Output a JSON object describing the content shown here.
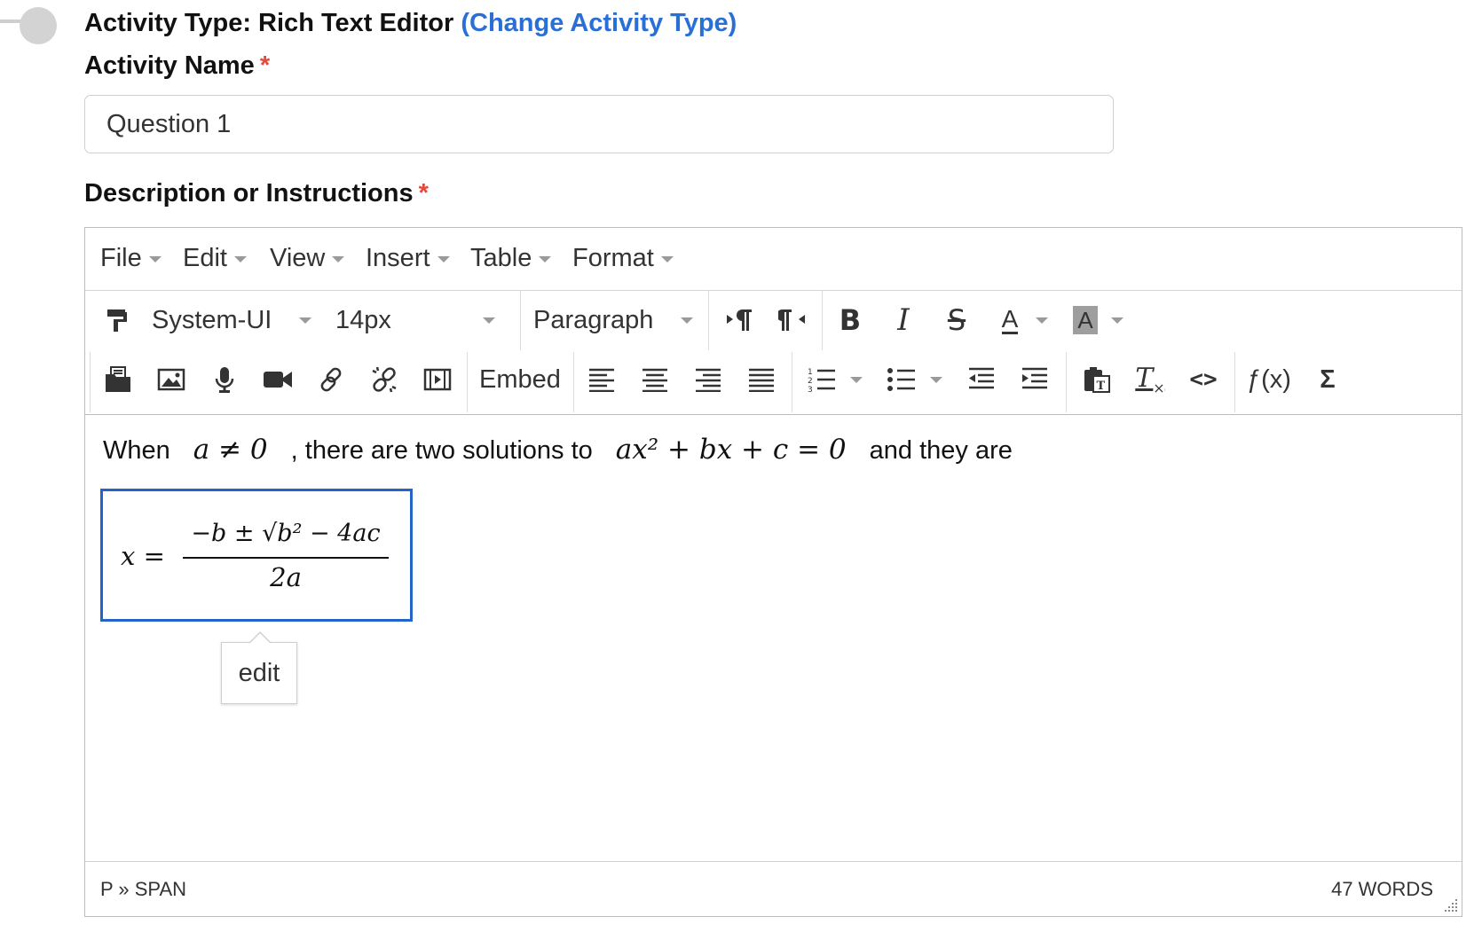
{
  "activity_type": {
    "prefix": "Activity Type: Rich Text Editor",
    "change_link": "(Change Activity Type)"
  },
  "activity_name": {
    "label": "Activity Name",
    "required_mark": "*",
    "value": "Question 1"
  },
  "description": {
    "label": "Description or Instructions",
    "required_mark": "*"
  },
  "editor": {
    "menu": [
      "File",
      "Edit",
      "View",
      "Insert",
      "Table",
      "Format"
    ],
    "toolbar": {
      "font_family": "System-UI",
      "font_size": "14px",
      "block_format": "Paragraph",
      "embed_label": "Embed",
      "function_label": "ƒ(x)",
      "sum_label": "Σ",
      "icons_row1": [
        "format-painter-icon",
        "ltr-icon",
        "rtl-icon",
        "bold-icon",
        "italic-icon",
        "strikethrough-icon",
        "text-color-icon",
        "background-color-icon"
      ],
      "icons_row2": [
        "file-manager-icon",
        "image-icon",
        "microphone-icon",
        "video-icon",
        "link-icon",
        "unlink-icon",
        "media-icon",
        "align-left-icon",
        "align-center-icon",
        "align-right-icon",
        "align-justify-icon",
        "numbered-list-icon",
        "bullet-list-icon",
        "outdent-icon",
        "indent-icon",
        "paste-text-icon",
        "clear-formatting-icon",
        "source-code-icon"
      ]
    },
    "content": {
      "text_1": "When",
      "math_1": "a ≠ 0",
      "text_2": ", there are two solutions to",
      "math_2": "ax² + bx + c = 0",
      "text_3": "and they are",
      "formula_lhs": "x =",
      "formula_numerator": "−b ± √b² − 4ac",
      "formula_denominator": "2a",
      "tooltip": "edit"
    },
    "status": {
      "path": "P » SPAN",
      "word_count": "47 WORDS"
    },
    "colors": {
      "selection": "#2463c9",
      "link": "#2a6fd6",
      "required": "#e5483a"
    }
  }
}
